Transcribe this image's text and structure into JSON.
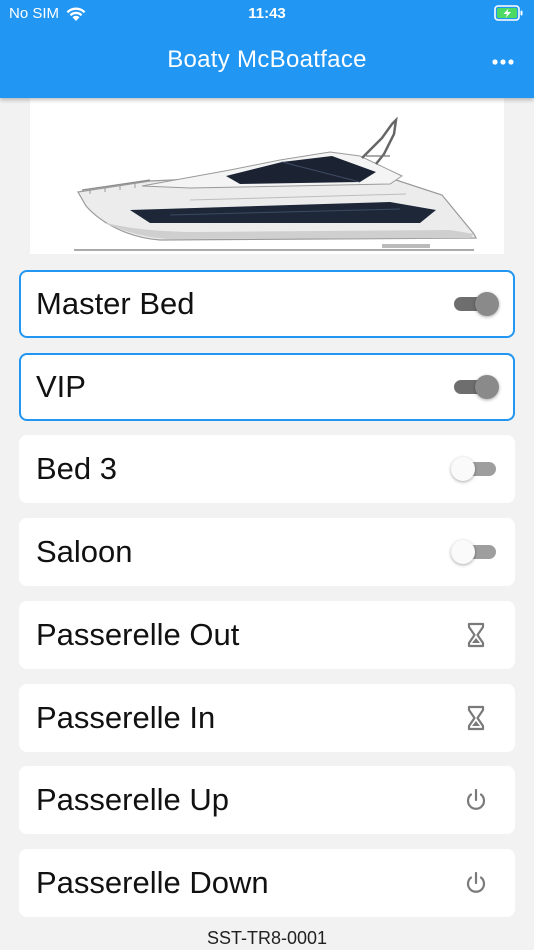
{
  "status_bar": {
    "carrier": "No SIM",
    "time": "11:43"
  },
  "app_bar": {
    "title": "Boaty McBoatface"
  },
  "controls": [
    {
      "label": "Master Bed",
      "kind": "toggle",
      "state": "on",
      "selected": true
    },
    {
      "label": "VIP",
      "kind": "toggle",
      "state": "on",
      "selected": true
    },
    {
      "label": "Bed 3",
      "kind": "toggle",
      "state": "off",
      "selected": false
    },
    {
      "label": "Saloon",
      "kind": "toggle",
      "state": "off",
      "selected": false
    },
    {
      "label": "Passerelle Out",
      "kind": "hourglass",
      "icon": "hourglass-icon"
    },
    {
      "label": "Passerelle In",
      "kind": "hourglass",
      "icon": "hourglass-icon"
    },
    {
      "label": "Passerelle Up",
      "kind": "power",
      "icon": "power-icon"
    },
    {
      "label": "Passerelle Down",
      "kind": "power",
      "icon": "power-icon"
    }
  ],
  "footer": {
    "device_id": "SST-TR8-0001"
  },
  "colors": {
    "primary": "#2196f3",
    "background": "#f2f2f2",
    "card": "#ffffff"
  }
}
